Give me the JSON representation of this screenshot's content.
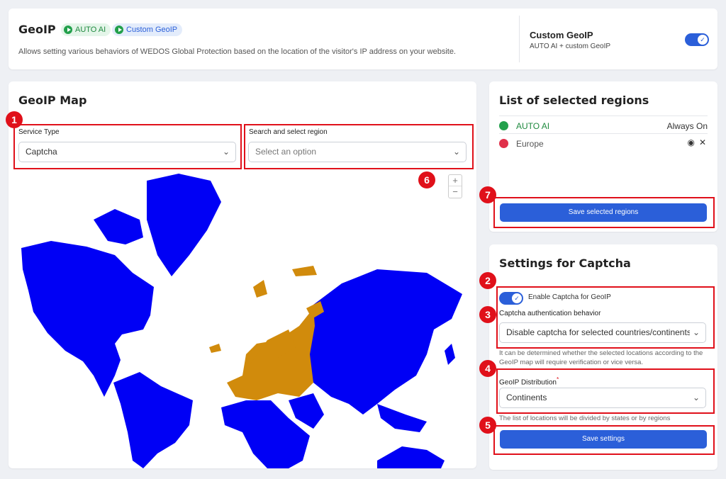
{
  "header": {
    "title": "GeoIP",
    "badge_auto": "AUTO AI",
    "badge_custom": "Custom GeoIP",
    "description": "Allows setting various behaviors of WEDOS Global Protection based on the location of the visitor's IP address on your website.",
    "custom_title": "Custom GeoIP",
    "custom_sub": "AUTO AI + custom GeoIP"
  },
  "map": {
    "title": "GeoIP Map",
    "service_type_label": "Service Type",
    "service_type_value": "Captcha",
    "region_label": "Search and select region",
    "region_placeholder": "Select an option",
    "zoom_in": "+",
    "zoom_out": "−"
  },
  "regions": {
    "title": "List of selected regions",
    "items": [
      {
        "name": "AUTO AI",
        "status": "Always On"
      },
      {
        "name": "Europe"
      }
    ],
    "save_label": "Save selected regions"
  },
  "settings": {
    "title": "Settings for Captcha",
    "enable_label": "Enable Captcha for GeoIP",
    "behavior_label": "Captcha authentication behavior",
    "behavior_value": "Disable captcha for selected countries/continents",
    "behavior_help": "It can be determined whether the selected locations according to the GeoIP map will require verification or vice versa.",
    "distribution_label": "GeoIP Distribution",
    "distribution_required": "*",
    "distribution_value": "Continents",
    "distribution_help": "The list of locations will be divided by states or by regions",
    "save_label": "Save settings"
  },
  "markers": [
    "1",
    "2",
    "3",
    "4",
    "5",
    "6",
    "7"
  ],
  "colors": {
    "accent": "#2b5fd9",
    "selected_region": "#d18b0c",
    "unselected_region": "#0000f5",
    "annotation": "#e0101a",
    "success": "#22a04b",
    "danger": "#e0304a"
  }
}
